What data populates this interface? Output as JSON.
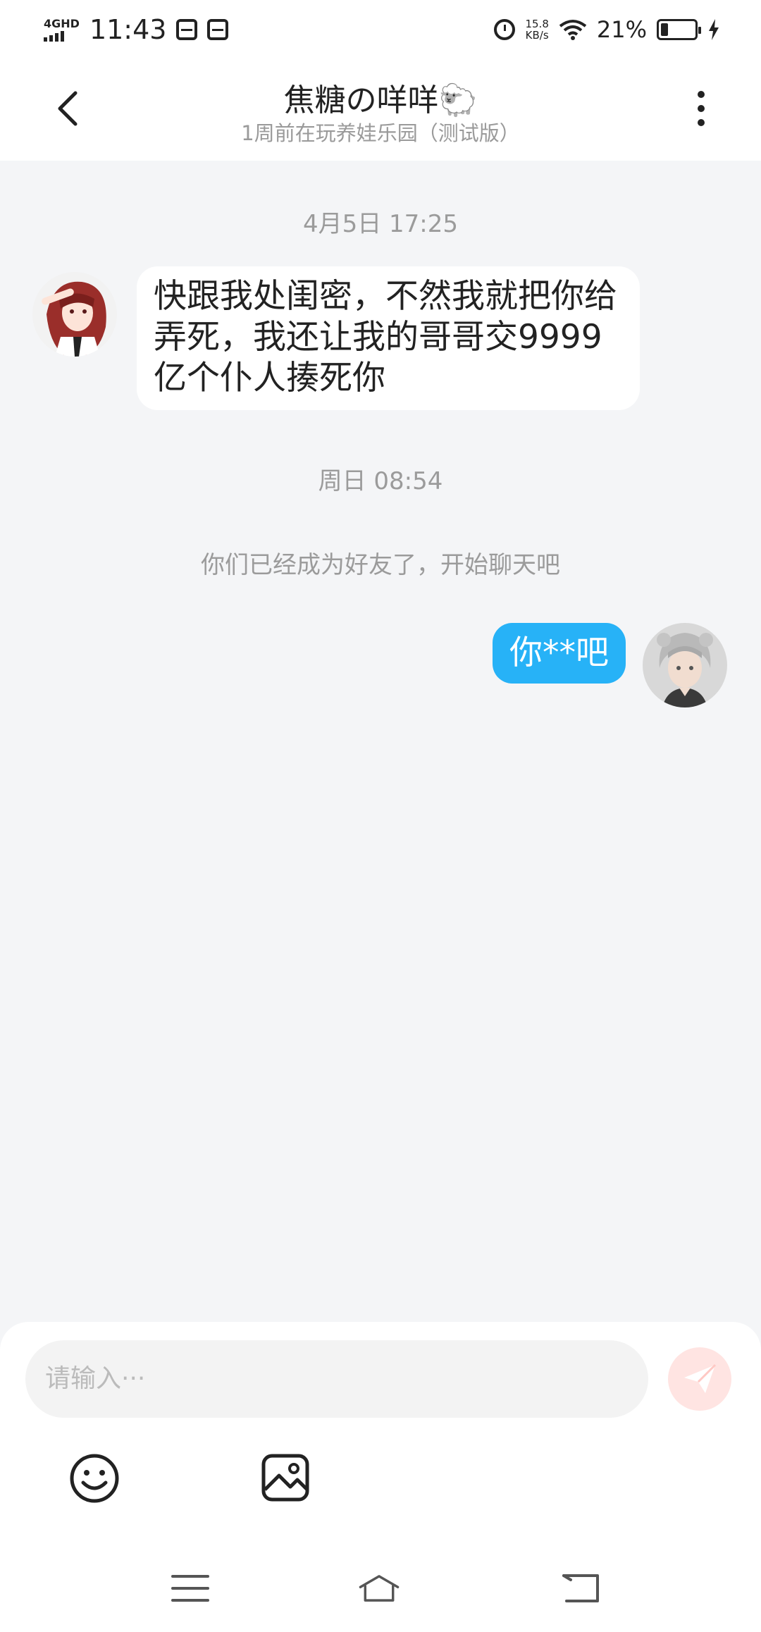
{
  "status_bar": {
    "network": "4GHD",
    "time": "11:43",
    "speed_value": "15.8",
    "speed_unit": "KB/s",
    "battery_pct": "21%",
    "battery_level": 0.21
  },
  "header": {
    "title": "焦糖の咩咩🐑",
    "subtitle": "1周前在玩养娃乐园（测试版）"
  },
  "chat": {
    "messages": [
      {
        "timestamp": "4月5日 17:25",
        "sender": "other",
        "text": "快跟我处闺密，不然我就把你给弄死，我还让我的哥哥交9999亿个仆人揍死你"
      },
      {
        "timestamp": "周日 08:54",
        "system_note": "你们已经成为好友了，开始聊天吧",
        "sender": "me",
        "text": "你**吧"
      }
    ]
  },
  "input": {
    "placeholder": "请输入···"
  },
  "colors": {
    "my_bubble": "#27b2f7",
    "background": "#f4f5f7",
    "send_button": "#ffe4e2"
  }
}
